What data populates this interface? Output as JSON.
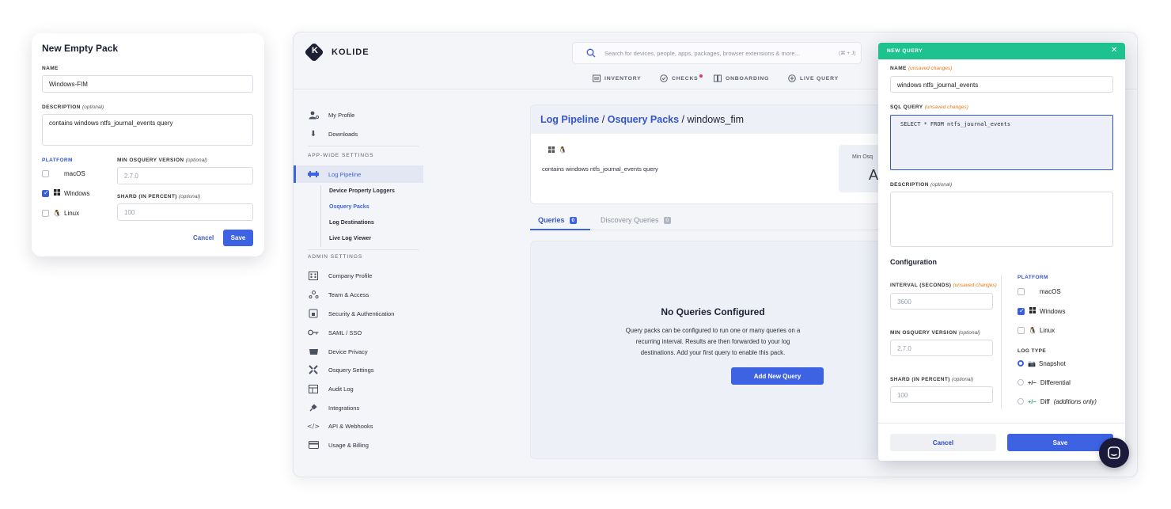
{
  "pack_modal": {
    "title": "New Empty Pack",
    "name_label": "NAME",
    "name_value": "Windows-FIM",
    "description_label": "DESCRIPTION",
    "description_optional": "(optional)",
    "description_value": "contains windows ntfs_journal_events query",
    "platform_label": "PLATFORM",
    "platforms": [
      {
        "label": "macOS",
        "checked": false,
        "icon": "apple-icon"
      },
      {
        "label": "Windows",
        "checked": true,
        "icon": "windows-icon"
      },
      {
        "label": "Linux",
        "checked": false,
        "icon": "linux-icon"
      }
    ],
    "min_version_label": "MIN OSQUERY VERSION",
    "min_version_optional": "(optional)",
    "min_version_placeholder": "2.7.0",
    "shard_label": "SHARD (IN PERCENT)",
    "shard_optional": "(optional)",
    "shard_placeholder": "100",
    "cancel_label": "Cancel",
    "save_label": "Save"
  },
  "header": {
    "logo_letter": "K",
    "logo_text": "KOLIDE",
    "search_placeholder": "Search for devices, people, apps, packages, browser extensions & more...",
    "search_shortcut": "(⌘ + J)",
    "nav": [
      {
        "label": "INVENTORY",
        "icon": "inventory-icon"
      },
      {
        "label": "CHECKS",
        "icon": "checks-icon",
        "alert_dot": true
      },
      {
        "label": "ONBOARDING",
        "icon": "onboarding-icon"
      },
      {
        "label": "LIVE QUERY",
        "icon": "live-query-icon"
      }
    ]
  },
  "sidebar": {
    "top_items": [
      {
        "label": "My Profile",
        "icon": "profile-icon"
      },
      {
        "label": "Downloads",
        "icon": "download-icon"
      }
    ],
    "app_wide_heading": "APP-WIDE SETTINGS",
    "log_pipeline": "Log Pipeline",
    "log_pipeline_subitems": [
      "Device Property Loggers",
      "Osquery Packs",
      "Log Destinations",
      "Live Log Viewer"
    ],
    "admin_heading": "ADMIN SETTINGS",
    "admin_items": [
      {
        "label": "Company Profile",
        "icon": "building-icon"
      },
      {
        "label": "Team & Access",
        "icon": "team-icon"
      },
      {
        "label": "Security & Authentication",
        "icon": "security-icon"
      },
      {
        "label": "SAML / SSO",
        "icon": "key-icon"
      },
      {
        "label": "Device Privacy",
        "icon": "privacy-icon"
      },
      {
        "label": "Osquery Settings",
        "icon": "osquery-icon"
      },
      {
        "label": "Audit Log",
        "icon": "audit-log-icon"
      },
      {
        "label": "Integrations",
        "icon": "plug-icon"
      },
      {
        "label": "API & Webhooks",
        "icon": "code-icon"
      },
      {
        "label": "Usage & Billing",
        "icon": "billing-icon"
      }
    ]
  },
  "pack": {
    "breadcrumb_1": "Log Pipeline",
    "breadcrumb_sep": " / ",
    "breadcrumb_2": "Osquery Packs",
    "breadcrumb_3": "windows_fim",
    "description": "contains windows ntfs_journal_events query",
    "min_os_label": "Min Osq",
    "min_os_value": "A"
  },
  "tabs": [
    {
      "label": "Queries",
      "count": "0"
    },
    {
      "label": "Discovery Queries",
      "count": "0"
    }
  ],
  "empty_state": {
    "title": "No Queries Configured",
    "body": "Query packs can be configured to run one or many queries on a recurring interval. Results are then forwarded to your log destinations. Add your first query to enable this pack.",
    "button": "Add New Query"
  },
  "query_panel": {
    "title": "NEW QUERY",
    "name_label": "NAME",
    "unsaved": "(unsaved changes)",
    "name_value": "windows ntfs_journal_events",
    "sql_label": "SQL QUERY",
    "sql_value": "SELECT * FROM ntfs_journal_events",
    "description_label": "DESCRIPTION",
    "description_optional": "(optional)",
    "configuration_label": "Configuration",
    "interval_label": "INTERVAL (SECONDS)",
    "interval_placeholder": "3600",
    "min_version_label": "MIN OSQUERY VERSION",
    "min_version_optional": "(optional)",
    "min_version_placeholder": "2.7.0",
    "shard_label": "SHARD (IN PERCENT)",
    "shard_optional": "(optional)",
    "shard_placeholder": "100",
    "platform_label": "PLATFORM",
    "platforms": [
      {
        "label": "macOS",
        "checked": false
      },
      {
        "label": "Windows",
        "checked": true
      },
      {
        "label": "Linux",
        "checked": false
      }
    ],
    "log_type_label": "LOG TYPE",
    "log_types": [
      {
        "label": "Snapshot",
        "selected": true,
        "glyph": ""
      },
      {
        "label": "Differential",
        "selected": false,
        "glyph": "+/−"
      },
      {
        "label": "Diff",
        "suffix": "(additions only)",
        "selected": false,
        "glyph": "+/−"
      }
    ],
    "cancel_label": "Cancel",
    "save_label": "Save"
  },
  "colors": {
    "accent": "#3d63e3",
    "panel_header": "#1dc28f",
    "unsaved": "#e77a1a"
  }
}
